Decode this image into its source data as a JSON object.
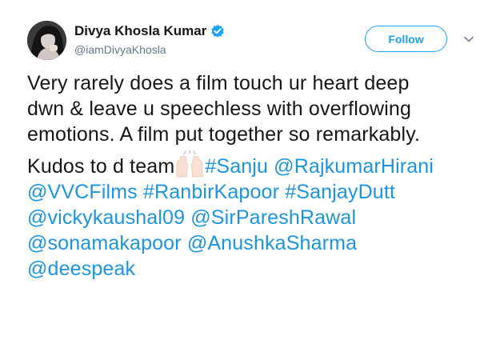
{
  "author": {
    "display_name": "Divya Khosla Kumar",
    "handle": "@iamDivyaKhosla",
    "verified": true,
    "verified_icon": "verified-badge-icon"
  },
  "actions": {
    "follow_label": "Follow",
    "more_icon": "chevron-down-icon"
  },
  "tweet": {
    "text_lines": [
      "Very rarely does a film touch ur heart deep",
      "dwn & leave u speechless with overflowing",
      "emotions. A film put together so remarkably."
    ],
    "kudos_text": "Kudos to d team",
    "emoji": "raising-hands-icon",
    "links": [
      "#Sanju",
      "@RajkumarHirani",
      "@VVCFilms",
      "#RanbirKapoor",
      "#SanjayDutt",
      "@vickykaushal09",
      "@SirPareshRawal",
      "@sonamakapoor",
      "@AnushkaSharma",
      "@deespeak"
    ]
  },
  "colors": {
    "link": "#1b95e0",
    "follow": "#1da1f2",
    "handle": "#657786",
    "text": "#14171a"
  }
}
